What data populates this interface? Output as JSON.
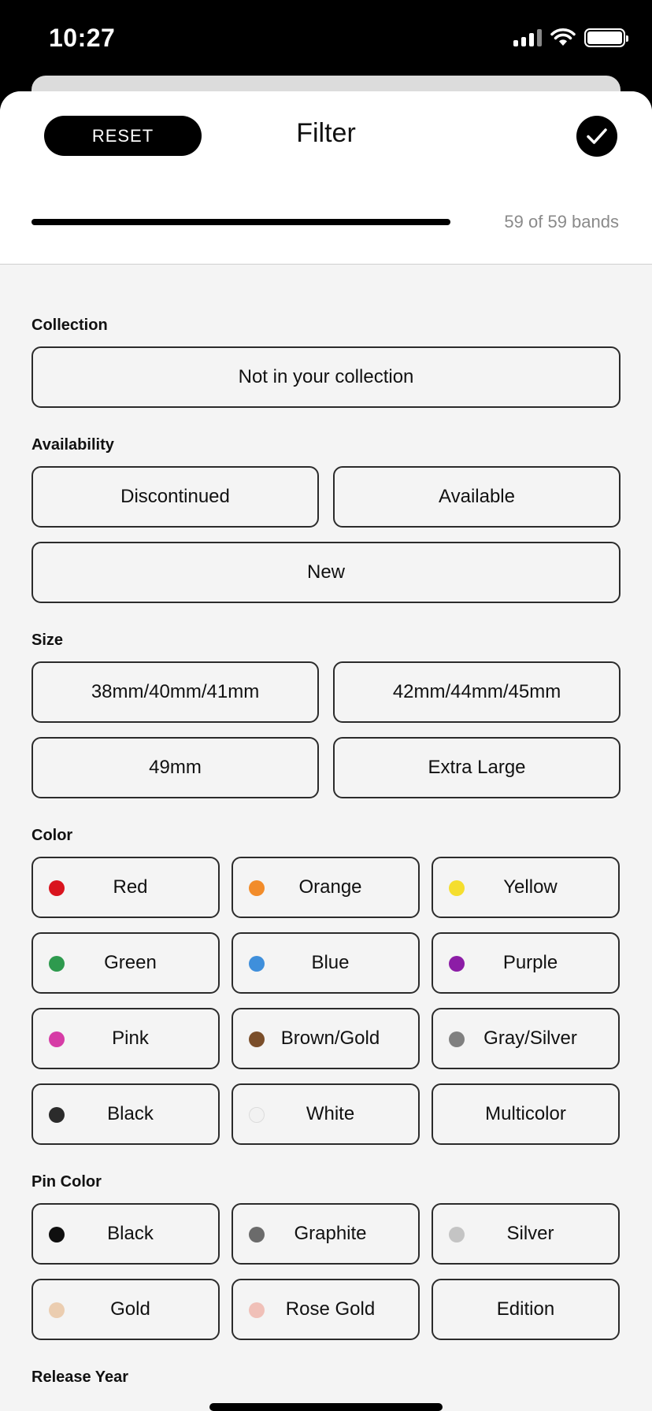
{
  "status_bar": {
    "time": "10:27"
  },
  "header": {
    "reset_label": "RESET",
    "title": "Filter",
    "progress": 1.0,
    "count_text": "59 of 59 bands"
  },
  "sections": {
    "collection": {
      "label": "Collection",
      "options": [
        "Not in your collection"
      ]
    },
    "availability": {
      "label": "Availability",
      "options": [
        "Discontinued",
        "Available",
        "New"
      ]
    },
    "size": {
      "label": "Size",
      "options": [
        "38mm/40mm/41mm",
        "42mm/44mm/45mm",
        "49mm",
        "Extra Large"
      ]
    },
    "color": {
      "label": "Color",
      "options": [
        {
          "name": "Red",
          "color": "#d9141e"
        },
        {
          "name": "Orange",
          "color": "#f28c2a"
        },
        {
          "name": "Yellow",
          "color": "#f5de2e"
        },
        {
          "name": "Green",
          "color": "#2e9a4e"
        },
        {
          "name": "Blue",
          "color": "#3f8fdb"
        },
        {
          "name": "Purple",
          "color": "#8c1da6"
        },
        {
          "name": "Pink",
          "color": "#d63ca6"
        },
        {
          "name": "Brown/Gold",
          "color": "#7a4e2a"
        },
        {
          "name": "Gray/Silver",
          "color": "#808080"
        },
        {
          "name": "Black",
          "color": "#2b2b2b"
        },
        {
          "name": "White",
          "color": "#f2f2f2"
        },
        {
          "name": "Multicolor",
          "color": ""
        }
      ]
    },
    "pin_color": {
      "label": "Pin Color",
      "options": [
        {
          "name": "Black",
          "color": "#0f0f0f"
        },
        {
          "name": "Graphite",
          "color": "#6b6b6b"
        },
        {
          "name": "Silver",
          "color": "#c4c4c4"
        },
        {
          "name": "Gold",
          "color": "#ebcdb0"
        },
        {
          "name": "Rose Gold",
          "color": "#f0c0b8"
        },
        {
          "name": "Edition",
          "color": ""
        }
      ]
    },
    "release_year": {
      "label": "Release Year"
    }
  }
}
